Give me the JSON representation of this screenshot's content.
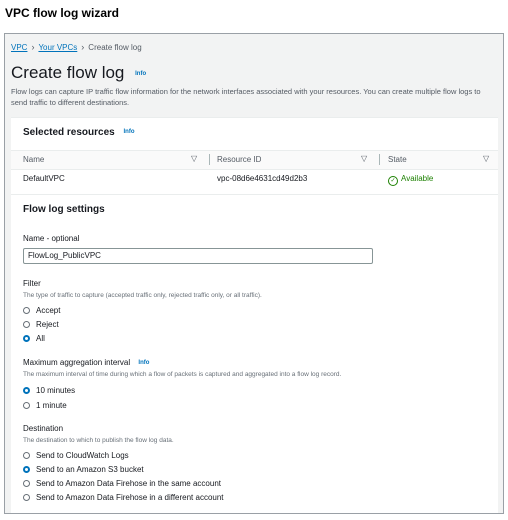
{
  "doc_title": "VPC flow log wizard",
  "breadcrumb": {
    "vpc": "VPC",
    "your_vpcs": "Your VPCs",
    "current": "Create flow log"
  },
  "page": {
    "title": "Create flow log",
    "info": "Info",
    "description": "Flow logs can capture IP traffic flow information for the network interfaces associated with your resources. You can create multiple flow logs to send traffic to different destinations."
  },
  "selected_resources": {
    "heading": "Selected resources",
    "info": "Info",
    "columns": [
      "Name",
      "Resource ID",
      "State"
    ],
    "row": {
      "name": "DefaultVPC",
      "resource_id": "vpc-08d6e4631cd49d2b3",
      "state": "Available"
    }
  },
  "settings": {
    "heading": "Flow log settings",
    "name_label": "Name - optional",
    "name_value": "FlowLog_PublicVPC",
    "filter": {
      "label": "Filter",
      "desc": "The type of traffic to capture (accepted traffic only, rejected traffic only, or all traffic).",
      "options": [
        "Accept",
        "Reject",
        "All"
      ],
      "selected": "All"
    },
    "interval": {
      "label": "Maximum aggregation interval",
      "info": "Info",
      "desc": "The maximum interval of time during which a flow of packets is captured and aggregated into a flow log record.",
      "options": [
        "10 minutes",
        "1 minute"
      ],
      "selected": "10 minutes"
    },
    "destination": {
      "label": "Destination",
      "desc": "The destination to which to publish the flow log data.",
      "options": [
        "Send to CloudWatch Logs",
        "Send to an Amazon S3 bucket",
        "Send to Amazon Data Firehose in the same account",
        "Send to Amazon Data Firehose in a different account"
      ],
      "selected": "Send to an Amazon S3 bucket"
    }
  },
  "colors": {
    "link": "#0073bb",
    "success": "#1d8102",
    "background": "#f2f3f3"
  },
  "icons": {
    "sort": "sort-down-icon",
    "breadcrumb_separator": "chevron-right-icon",
    "status": "check-circle-icon"
  }
}
